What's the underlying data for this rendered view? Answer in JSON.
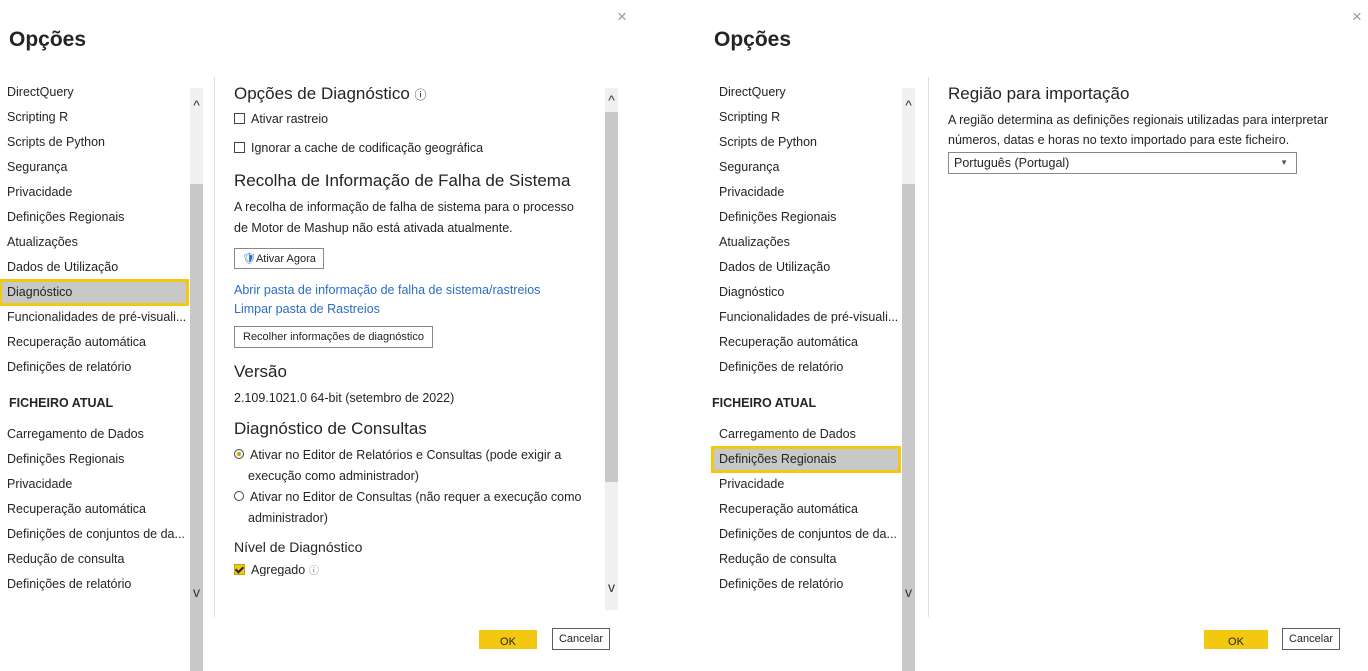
{
  "left_panel": {
    "title": "Opções",
    "nav_global": [
      "DirectQuery",
      "Scripting R",
      "Scripts de Python",
      "Segurança",
      "Privacidade",
      "Definições Regionais",
      "Atualizações",
      "Dados de Utilização",
      "Diagnóstico",
      "Funcionalidades de pré-visuali...",
      "Recuperação automática",
      "Definições de relatório"
    ],
    "nav_header": "FICHEIRO ATUAL",
    "nav_file": [
      "Carregamento de Dados",
      "Definições Regionais",
      "Privacidade",
      "Recuperação automática",
      "Definições de conjuntos de da...",
      "Redução de consulta",
      "Definições de relatório"
    ],
    "selected": "Diagnóstico",
    "content": {
      "diag_title": "Opções de Diagnóstico",
      "info_icon": "ⓘ",
      "cb_trace": "Ativar rastreio",
      "cb_geo": "Ignorar a cache de codificação geográfica",
      "crash_title": "Recolha de Informação de Falha de Sistema",
      "crash_text": "A recolha de informação de falha de sistema para o processo de Motor de Mashup não está ativada atualmente.",
      "enable_btn": "Ativar Agora",
      "link_open": "Abrir pasta de informação de falha de sistema/rastreios",
      "link_clear": "Limpar pasta de Rastreios",
      "collect_btn": "Recolher informações de diagnóstico",
      "version_title": "Versão",
      "version_text": "2.109.1021.0 64-bit (setembro de 2022)",
      "query_title": "Diagnóstico de Consultas",
      "radio1": "Ativar no Editor de Relatórios e Consultas (pode exigir a execução como administrador)",
      "radio2": "Ativar no Editor de Consultas (não requer a execução como administrador)",
      "level_title": "Nível de Diagnóstico",
      "cb_aggregate": "Agregado"
    },
    "ok": "OK",
    "cancel": "Cancelar"
  },
  "right_panel": {
    "title": "Opções",
    "nav_global": [
      "DirectQuery",
      "Scripting R",
      "Scripts de Python",
      "Segurança",
      "Privacidade",
      "Definições Regionais",
      "Atualizações",
      "Dados de Utilização",
      "Diagnóstico",
      "Funcionalidades de pré-visuali...",
      "Recuperação automática",
      "Definições de relatório"
    ],
    "nav_header": "FICHEIRO ATUAL",
    "nav_file": [
      "Carregamento de Dados",
      "Definições Regionais",
      "Privacidade",
      "Recuperação automática",
      "Definições de conjuntos de da...",
      "Redução de consulta",
      "Definições de relatório"
    ],
    "selected": "Definições Regionais",
    "content": {
      "region_title": "Região para importação",
      "region_text": "A região determina as definições regionais utilizadas para interpretar números, datas e horas no texto importado para este ficheiro.",
      "region_value": "Português (Portugal)"
    },
    "ok": "OK",
    "cancel": "Cancelar"
  },
  "colors": {
    "accent": "#f2c811",
    "link": "#2b6ec5",
    "selected_bg": "#c8c8c8"
  },
  "icons": {
    "close": "×",
    "chevron_up": "⌃",
    "chevron_down": "⌄"
  }
}
